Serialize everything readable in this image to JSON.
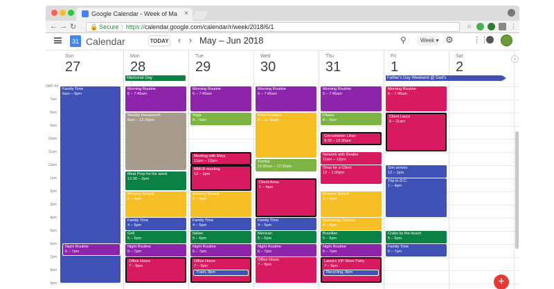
{
  "browser": {
    "tab_title": "Google Calendar - Week of Ma",
    "tab_close": "×",
    "secure_label": "Secure",
    "url_scheme": "https://",
    "url_rest": "calendar.google.com/calendar/r/week/2018/6/1"
  },
  "header": {
    "logo_day": "31",
    "title": "Calendar",
    "today_label": "TODAY",
    "range": "May – Jun 2018",
    "view": "Week"
  },
  "timezone": "GMT-04",
  "days": [
    {
      "name": "Sun",
      "num": "27"
    },
    {
      "name": "Mon",
      "num": "28"
    },
    {
      "name": "Tue",
      "num": "29"
    },
    {
      "name": "Wed",
      "num": "30"
    },
    {
      "name": "Thu",
      "num": "31"
    },
    {
      "name": "Fri",
      "num": "1"
    },
    {
      "name": "Sat",
      "num": "2"
    }
  ],
  "hours": [
    "7am",
    "8am",
    "9am",
    "10am",
    "11am",
    "12pm",
    "1pm",
    "2pm",
    "3pm",
    "4pm",
    "5pm",
    "6pm",
    "7pm",
    "8pm",
    "9pm"
  ],
  "all_day": [
    {
      "title": "Memorial Day",
      "color": "#0b8043"
    },
    {
      "title": "Father's Day Weekend @ Dad's",
      "color": "#3f51b5"
    }
  ],
  "colors": {
    "purple": "#8e24aa",
    "green": "#0b8043",
    "light_green": "#7cb342",
    "yellow": "#f6bf26",
    "blue": "#3f51b5",
    "pink": "#d81b60",
    "taupe": "#a79b8e",
    "teal": "#039be5"
  },
  "events": {
    "sun_family": {
      "title": "Family Time",
      "time": "6am – 9pm"
    },
    "sun_night": {
      "title": "Night Routine",
      "time": "6 – 7pm"
    },
    "mon_morning": {
      "title": "Morning Routine",
      "time": "6 – 7:45am"
    },
    "mon_housework": {
      "title": "Weekly Housework",
      "time": "8am – 12:30pm"
    },
    "mon_mealprep": {
      "title": "Meal Prep for the week",
      "time": "12:30 – 2pm"
    },
    "mon_mommy": {
      "title": "Mommy School",
      "time": "2 – 4pm"
    },
    "mon_family": {
      "title": "Family Time",
      "time": "4 – 5pm"
    },
    "mon_grill": {
      "title": "Grill",
      "time": "5 – 6pm"
    },
    "mon_night": {
      "title": "Night Routine",
      "time": "6 – 7pm"
    },
    "mon_office": {
      "title": "Office Hours",
      "time": "7 – 9pm"
    },
    "tue_morning": {
      "title": "Morning Routine",
      "time": "6 – 7:45am"
    },
    "tue_yoga": {
      "title": "Yoga",
      "time": "8 – 9am"
    },
    "tue_meeting": {
      "title": "Meeting with Mary",
      "time": "11am – 12pm"
    },
    "tue_mmlb": {
      "title": "MMLB meeting",
      "time": "12 – 2pm"
    },
    "tue_mommy": {
      "title": "Mommy School",
      "time": "2 – 4pm"
    },
    "tue_family": {
      "title": "Family Time",
      "time": "4 – 5pm"
    },
    "tue_italian": {
      "title": "Italian",
      "time": "5 – 6pm"
    },
    "tue_night": {
      "title": "Night Routine",
      "time": "6 – 7pm"
    },
    "tue_office": {
      "title": "Office Hours",
      "time": "7 – 9pm"
    },
    "tue_trash": {
      "title": "Trash, 8pm"
    },
    "wed_morning": {
      "title": "Morning Routine",
      "time": "6 – 7:45am"
    },
    "wed_kids": {
      "title": "Kid's Activities",
      "time": "8 – 11:30am"
    },
    "wed_zumba": {
      "title": "Zumba",
      "time": "11:30am – 12:30pm"
    },
    "wed_client": {
      "title": "Client Anna",
      "time": "1 – 4pm"
    },
    "wed_family": {
      "title": "Family Time",
      "time": "4 – 5pm"
    },
    "wed_mexican": {
      "title": "Mexican",
      "time": "5 – 6pm"
    },
    "wed_night": {
      "title": "Night Routine",
      "time": "6 – 7pm"
    },
    "wed_office": {
      "title": "Office Hours",
      "time": "7 – 9pm"
    },
    "thu_morning": {
      "title": "Morning Routine",
      "time": "6 – 7:45am"
    },
    "thu_pilates": {
      "title": "Pilates",
      "time": "8 – 9am"
    },
    "thu_consult": {
      "title": "Consultation Lilian",
      "time": "9:30 – 10:30am"
    },
    "thu_network": {
      "title": "Network with Realtor",
      "time": "11am – 12pm"
    },
    "thu_shop": {
      "title": "Shop for a Client",
      "time": "12 – 1:30pm"
    },
    "thu_mommy": {
      "title": "Mommy School",
      "time": "2 – 4pm"
    },
    "thu_swim": {
      "title": "Swimming Classes",
      "time": "4 – 5pm"
    },
    "thu_brazilian": {
      "title": "Brazilian",
      "time": "5 – 6pm"
    },
    "thu_night": {
      "title": "Night Routine",
      "time": "6 – 7pm"
    },
    "thu_party": {
      "title": "Laura's VIP Store Party",
      "time": "7 – 9pm"
    },
    "thu_recycling": {
      "title": "Recycling, 8pm"
    },
    "fri_morning": {
      "title": "Morning Routine",
      "time": "6 – 7:45am"
    },
    "fri_client": {
      "title": "Client Laura",
      "time": "8 – 11am"
    },
    "fri_son": {
      "title": "Son arrives",
      "time": "12 – 1pm"
    },
    "fri_trip": {
      "title": "Trip to D.C.",
      "time": "1 – 4pm"
    },
    "fri_crabs": {
      "title": "Crabs by the beach",
      "time": "5 – 6pm"
    },
    "fri_family": {
      "title": "Family Time",
      "time": "6 – 7pm"
    }
  },
  "fab_label": "+"
}
